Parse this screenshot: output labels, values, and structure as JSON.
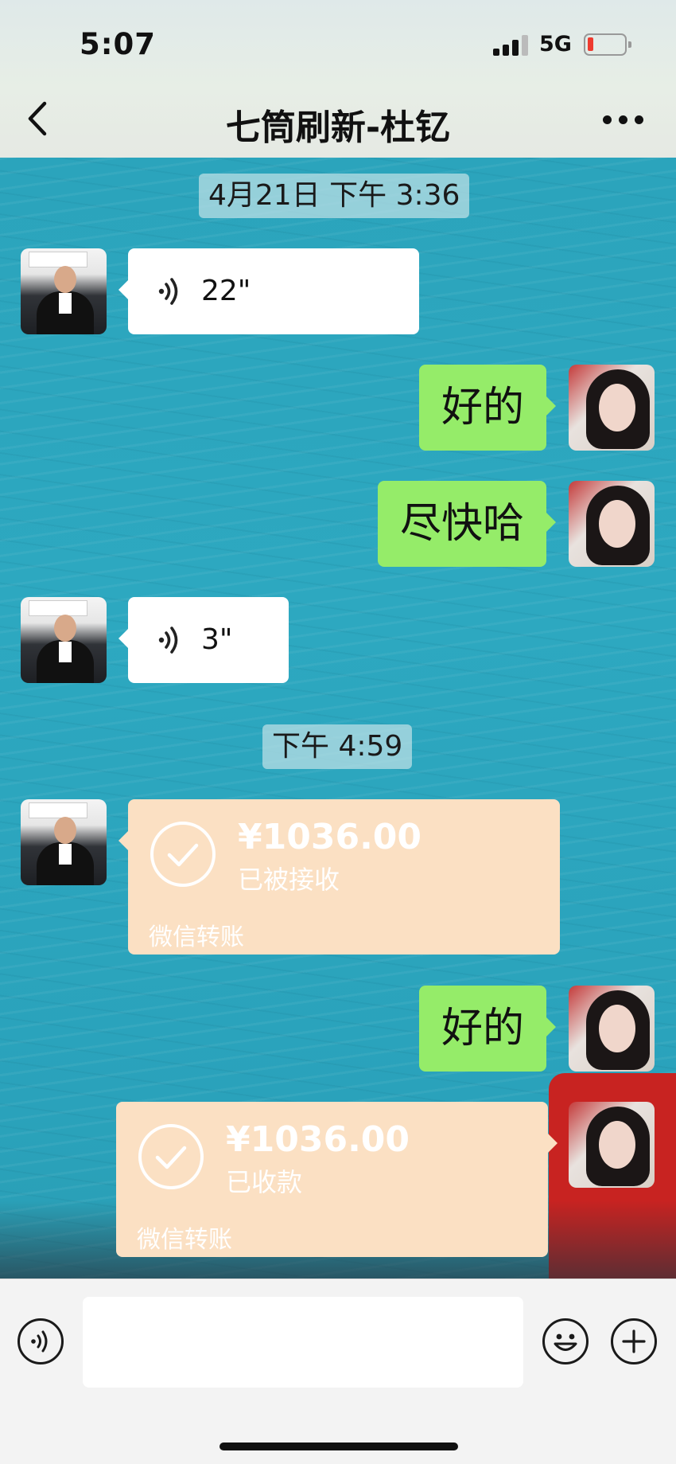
{
  "status_bar": {
    "time": "5:07",
    "network": "5G"
  },
  "header": {
    "title": "七筒刷新-杜钇"
  },
  "icons": {
    "back": "chevron-left-icon",
    "more": "more-dots-icon",
    "voice": "voice-wave-icon",
    "check": "check-circle-icon",
    "emoji": "emoji-icon",
    "plus": "plus-circle-icon"
  },
  "colors": {
    "chat_bg": "#2aa4bc",
    "out_bubble": "#95ec69",
    "in_bubble": "#ffffff",
    "transfer": "#fbe0c3"
  },
  "messages": [
    {
      "type": "timestamp",
      "text": "4月21日 下午 3:36"
    },
    {
      "type": "voice",
      "sender": "other",
      "duration": "22\""
    },
    {
      "type": "text",
      "sender": "me",
      "text": "好的"
    },
    {
      "type": "text",
      "sender": "me",
      "text": "尽快哈"
    },
    {
      "type": "voice",
      "sender": "other",
      "duration": "3\""
    },
    {
      "type": "timestamp",
      "text": "下午 4:59"
    },
    {
      "type": "transfer",
      "sender": "other",
      "amount": "¥1036.00",
      "status": "已被接收",
      "label": "微信转账"
    },
    {
      "type": "text",
      "sender": "me",
      "text": "好的"
    },
    {
      "type": "transfer",
      "sender": "me",
      "amount": "¥1036.00",
      "status": "已收款",
      "label": "微信转账"
    }
  ],
  "input_bar": {
    "value": ""
  }
}
